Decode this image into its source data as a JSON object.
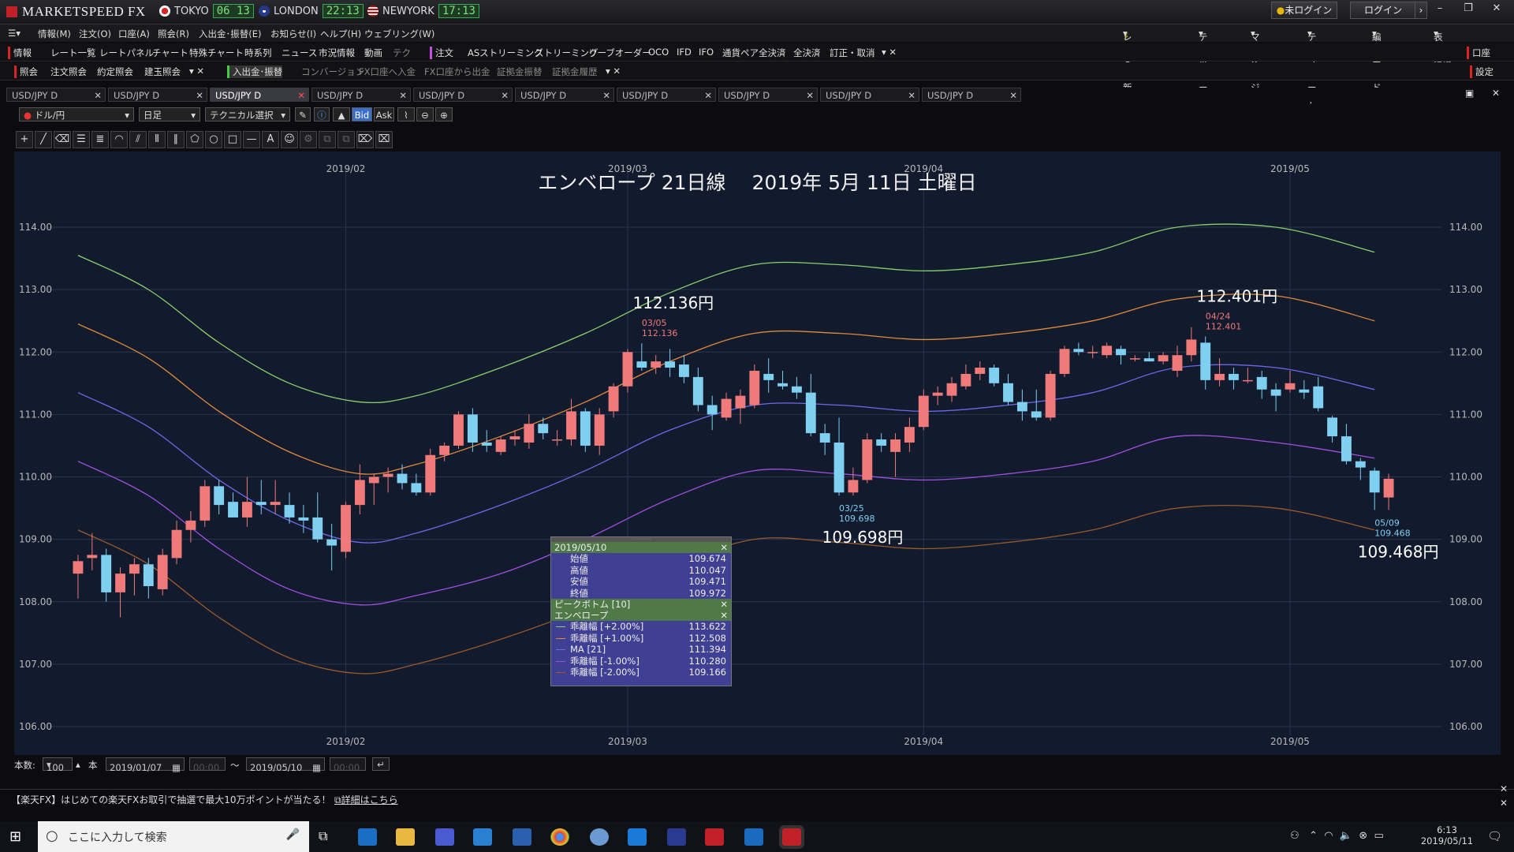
{
  "app": {
    "title": "MARKETSPEED FX"
  },
  "clocks": [
    {
      "city": "TOKYO",
      "time": "06 13"
    },
    {
      "city": "LONDON",
      "time": "22:13"
    },
    {
      "city": "NEWYORK",
      "time": "17:13"
    }
  ],
  "topbar": {
    "login_status": "未ログイン",
    "login_button": "ログイン"
  },
  "menu": [
    "情報(M)",
    "注文(O)",
    "口座(A)",
    "照会(R)",
    "入出金･振替(E)",
    "お知らせ(I)",
    "ヘルプ(H)",
    "ウェブリング(W)"
  ],
  "menu_right": [
    "レート更新",
    "ティッカー",
    "マイページ",
    "テンプレート",
    "編集モード",
    "表示・環境設定"
  ],
  "toolbar1": {
    "group_label": "情報",
    "items": [
      "レート一覧",
      "レートパネル",
      "チャート",
      "特殊チャート",
      "時系列",
      "ニュース",
      "市況情報",
      "動画",
      "テク"
    ],
    "order_label": "注文",
    "order_items": [
      "ASストリーミング",
      "ストリーミング",
      "リーブオーダー",
      "OCO",
      "IFD",
      "IFO",
      "通貨ペア全決済",
      "全決済",
      "訂正・取消"
    ],
    "right_label": "口座"
  },
  "toolbar2": {
    "group_label": "照会",
    "items": [
      "注文照会",
      "約定照会",
      "建玉照会"
    ],
    "transfer_label": "入出金･振替",
    "transfer_items": [
      "コンバージョン",
      "FX口座へ入金",
      "FX口座から出金",
      "証拠金振替",
      "証拠金履歴"
    ],
    "right_label": "設定"
  },
  "tabs": [
    "USD/JPY D",
    "USD/JPY D",
    "USD/JPY D",
    "USD/JPY D",
    "USD/JPY D",
    "USD/JPY D",
    "USD/JPY D",
    "USD/JPY D",
    "USD/JPY D",
    "USD/JPY D"
  ],
  "active_tab": 2,
  "chart_controls": {
    "pair": "ドル/円",
    "period": "日足",
    "technical": "テクニカル選択",
    "bid": "Bid",
    "ask": "Ask"
  },
  "footer": {
    "count_label": "本数:",
    "count_value": "100",
    "unit": "本",
    "from_date": "2019/01/07",
    "from_time": "00:00",
    "tilde": "～",
    "to_date": "2019/05/10",
    "to_time": "00:00"
  },
  "promo": {
    "text": "【楽天FX】はじめての楽天FXお取引で抽選で最大10万ポイントが当たる！",
    "link": "詳細はこちら"
  },
  "taskbar": {
    "search_placeholder": "ここに入力して検索",
    "time": "6:13",
    "date": "2019/05/11"
  },
  "info_panel": {
    "date": "2019/05/10",
    "ohlc": [
      {
        "label": "始値",
        "value": "109.674"
      },
      {
        "label": "高値",
        "value": "110.047"
      },
      {
        "label": "安値",
        "value": "109.471"
      },
      {
        "label": "終値",
        "value": "109.972"
      }
    ],
    "peak_label": "ピークボトム [10]",
    "env_label": "エンベロープ",
    "env_rows": [
      {
        "label": "乖離幅 [+2.00%]",
        "value": "113.622",
        "color": "#8ad06a"
      },
      {
        "label": "乖離幅 [+1.00%]",
        "value": "112.508",
        "color": "#e08a3a"
      },
      {
        "label": "MA [21]",
        "value": "111.394",
        "color": "#6a6ae8"
      },
      {
        "label": "乖離幅 [-1.00%]",
        "value": "110.280",
        "color": "#a050e0"
      },
      {
        "label": "乖離幅 [-2.00%]",
        "value": "109.166",
        "color": "#9a5a2a"
      }
    ]
  },
  "chart_data": {
    "type": "candlestick",
    "title": "エンベロープ 21日線　 2019年 5月 11日 土曜日",
    "ylim": [
      106.0,
      114.5
    ],
    "yticks": [
      "114.00",
      "113.00",
      "112.00",
      "111.00",
      "110.00",
      "109.00",
      "108.00",
      "107.00",
      "106.00"
    ],
    "month_labels": [
      "2019/02",
      "2019/03",
      "2019/04",
      "2019/05"
    ],
    "candles": [
      {
        "o": 108.45,
        "h": 108.75,
        "l": 108.05,
        "c": 108.65
      },
      {
        "o": 108.7,
        "h": 109.1,
        "l": 108.5,
        "c": 108.75
      },
      {
        "o": 108.75,
        "h": 108.85,
        "l": 108.0,
        "c": 108.15
      },
      {
        "o": 108.15,
        "h": 108.55,
        "l": 107.75,
        "c": 108.45
      },
      {
        "o": 108.45,
        "h": 108.7,
        "l": 108.1,
        "c": 108.6
      },
      {
        "o": 108.6,
        "h": 108.7,
        "l": 108.05,
        "c": 108.25
      },
      {
        "o": 108.2,
        "h": 108.85,
        "l": 108.1,
        "c": 108.75
      },
      {
        "o": 108.7,
        "h": 109.3,
        "l": 108.6,
        "c": 109.15
      },
      {
        "o": 109.15,
        "h": 109.45,
        "l": 108.95,
        "c": 109.3
      },
      {
        "o": 109.3,
        "h": 109.95,
        "l": 109.2,
        "c": 109.85
      },
      {
        "o": 109.85,
        "h": 109.95,
        "l": 109.4,
        "c": 109.55
      },
      {
        "o": 109.6,
        "h": 109.75,
        "l": 109.35,
        "c": 109.35
      },
      {
        "o": 109.35,
        "h": 110.0,
        "l": 109.2,
        "c": 109.6
      },
      {
        "o": 109.6,
        "h": 109.95,
        "l": 109.4,
        "c": 109.55
      },
      {
        "o": 109.55,
        "h": 109.95,
        "l": 109.4,
        "c": 109.6
      },
      {
        "o": 109.55,
        "h": 109.75,
        "l": 109.25,
        "c": 109.35
      },
      {
        "o": 109.35,
        "h": 109.55,
        "l": 109.1,
        "c": 109.3
      },
      {
        "o": 109.35,
        "h": 109.75,
        "l": 108.95,
        "c": 109.0
      },
      {
        "o": 109.0,
        "h": 109.25,
        "l": 108.5,
        "c": 108.9
      },
      {
        "o": 108.8,
        "h": 109.6,
        "l": 108.7,
        "c": 109.55
      },
      {
        "o": 109.55,
        "h": 110.2,
        "l": 109.4,
        "c": 109.95
      },
      {
        "o": 109.9,
        "h": 110.05,
        "l": 109.55,
        "c": 110.0
      },
      {
        "o": 110.0,
        "h": 110.15,
        "l": 109.75,
        "c": 110.05
      },
      {
        "o": 110.05,
        "h": 110.2,
        "l": 109.8,
        "c": 109.9
      },
      {
        "o": 109.9,
        "h": 110.05,
        "l": 109.7,
        "c": 109.75
      },
      {
        "o": 109.75,
        "h": 110.45,
        "l": 109.7,
        "c": 110.35
      },
      {
        "o": 110.35,
        "h": 110.55,
        "l": 110.25,
        "c": 110.5
      },
      {
        "o": 110.5,
        "h": 111.05,
        "l": 110.45,
        "c": 111.0
      },
      {
        "o": 111.0,
        "h": 111.1,
        "l": 110.4,
        "c": 110.55
      },
      {
        "o": 110.55,
        "h": 110.75,
        "l": 110.4,
        "c": 110.5
      },
      {
        "o": 110.4,
        "h": 110.65,
        "l": 110.35,
        "c": 110.6
      },
      {
        "o": 110.6,
        "h": 110.75,
        "l": 110.5,
        "c": 110.65
      },
      {
        "o": 110.55,
        "h": 111.0,
        "l": 110.45,
        "c": 110.85
      },
      {
        "o": 110.85,
        "h": 110.95,
        "l": 110.6,
        "c": 110.7
      },
      {
        "o": 110.6,
        "h": 110.75,
        "l": 110.5,
        "c": 110.6
      },
      {
        "o": 110.6,
        "h": 111.25,
        "l": 110.5,
        "c": 111.05
      },
      {
        "o": 111.05,
        "h": 111.1,
        "l": 110.4,
        "c": 110.5
      },
      {
        "o": 110.5,
        "h": 111.1,
        "l": 110.35,
        "c": 111.0
      },
      {
        "o": 111.05,
        "h": 111.5,
        "l": 110.95,
        "c": 111.45
      },
      {
        "o": 111.45,
        "h": 112.05,
        "l": 111.35,
        "c": 112.0
      },
      {
        "o": 111.85,
        "h": 112.14,
        "l": 111.7,
        "c": 111.75
      },
      {
        "o": 111.75,
        "h": 111.95,
        "l": 111.65,
        "c": 111.85
      },
      {
        "o": 111.85,
        "h": 112.05,
        "l": 111.6,
        "c": 111.75
      },
      {
        "o": 111.8,
        "h": 111.95,
        "l": 111.5,
        "c": 111.6
      },
      {
        "o": 111.6,
        "h": 111.75,
        "l": 111.05,
        "c": 111.15
      },
      {
        "o": 111.15,
        "h": 111.3,
        "l": 110.75,
        "c": 111.0
      },
      {
        "o": 110.95,
        "h": 111.35,
        "l": 110.9,
        "c": 111.25
      },
      {
        "o": 111.1,
        "h": 111.4,
        "l": 110.85,
        "c": 111.3
      },
      {
        "o": 111.15,
        "h": 111.8,
        "l": 111.1,
        "c": 111.7
      },
      {
        "o": 111.65,
        "h": 111.9,
        "l": 111.35,
        "c": 111.55
      },
      {
        "o": 111.5,
        "h": 111.7,
        "l": 111.4,
        "c": 111.45
      },
      {
        "o": 111.45,
        "h": 111.6,
        "l": 111.25,
        "c": 111.35
      },
      {
        "o": 111.35,
        "h": 111.65,
        "l": 110.65,
        "c": 110.7
      },
      {
        "o": 110.7,
        "h": 110.85,
        "l": 110.35,
        "c": 110.55
      },
      {
        "o": 110.55,
        "h": 110.95,
        "l": 109.7,
        "c": 109.75
      },
      {
        "o": 109.75,
        "h": 110.15,
        "l": 109.7,
        "c": 109.95
      },
      {
        "o": 109.95,
        "h": 110.7,
        "l": 109.9,
        "c": 110.6
      },
      {
        "o": 110.6,
        "h": 110.7,
        "l": 110.4,
        "c": 110.5
      },
      {
        "o": 110.4,
        "h": 110.7,
        "l": 110.0,
        "c": 110.6
      },
      {
        "o": 110.55,
        "h": 110.95,
        "l": 110.4,
        "c": 110.8
      },
      {
        "o": 110.8,
        "h": 111.4,
        "l": 110.75,
        "c": 111.3
      },
      {
        "o": 111.3,
        "h": 111.45,
        "l": 111.15,
        "c": 111.35
      },
      {
        "o": 111.3,
        "h": 111.6,
        "l": 111.2,
        "c": 111.5
      },
      {
        "o": 111.45,
        "h": 111.8,
        "l": 111.4,
        "c": 111.65
      },
      {
        "o": 111.65,
        "h": 111.85,
        "l": 111.55,
        "c": 111.75
      },
      {
        "o": 111.75,
        "h": 111.8,
        "l": 111.45,
        "c": 111.5
      },
      {
        "o": 111.5,
        "h": 111.65,
        "l": 111.15,
        "c": 111.2
      },
      {
        "o": 111.2,
        "h": 111.4,
        "l": 110.9,
        "c": 111.05
      },
      {
        "o": 111.05,
        "h": 111.4,
        "l": 110.9,
        "c": 110.95
      },
      {
        "o": 110.95,
        "h": 111.7,
        "l": 110.9,
        "c": 111.65
      },
      {
        "o": 111.65,
        "h": 112.1,
        "l": 111.6,
        "c": 112.05
      },
      {
        "o": 112.05,
        "h": 112.15,
        "l": 111.95,
        "c": 112.0
      },
      {
        "o": 112.0,
        "h": 112.1,
        "l": 111.9,
        "c": 112.0
      },
      {
        "o": 111.95,
        "h": 112.15,
        "l": 111.9,
        "c": 112.1
      },
      {
        "o": 112.05,
        "h": 112.1,
        "l": 111.8,
        "c": 111.95
      },
      {
        "o": 111.9,
        "h": 111.95,
        "l": 111.85,
        "c": 111.9
      },
      {
        "o": 111.9,
        "h": 112.0,
        "l": 111.85,
        "c": 111.85
      },
      {
        "o": 111.85,
        "h": 112.0,
        "l": 111.8,
        "c": 111.95
      },
      {
        "o": 111.7,
        "h": 112.1,
        "l": 111.6,
        "c": 111.95
      },
      {
        "o": 111.95,
        "h": 112.4,
        "l": 111.85,
        "c": 112.2
      },
      {
        "o": 112.15,
        "h": 112.25,
        "l": 111.4,
        "c": 111.55
      },
      {
        "o": 111.55,
        "h": 111.9,
        "l": 111.45,
        "c": 111.65
      },
      {
        "o": 111.65,
        "h": 111.75,
        "l": 111.4,
        "c": 111.55
      },
      {
        "o": 111.55,
        "h": 111.75,
        "l": 111.5,
        "c": 111.55
      },
      {
        "o": 111.6,
        "h": 111.7,
        "l": 111.25,
        "c": 111.4
      },
      {
        "o": 111.4,
        "h": 111.5,
        "l": 111.05,
        "c": 111.3
      },
      {
        "o": 111.4,
        "h": 111.7,
        "l": 111.35,
        "c": 111.5
      },
      {
        "o": 111.4,
        "h": 111.55,
        "l": 111.25,
        "c": 111.35
      },
      {
        "o": 111.45,
        "h": 111.6,
        "l": 111.05,
        "c": 111.1
      },
      {
        "o": 110.95,
        "h": 110.98,
        "l": 110.55,
        "c": 110.65
      },
      {
        "o": 110.65,
        "h": 110.85,
        "l": 110.2,
        "c": 110.25
      },
      {
        "o": 110.25,
        "h": 110.3,
        "l": 109.95,
        "c": 110.15
      },
      {
        "o": 110.1,
        "h": 110.15,
        "l": 109.47,
        "c": 109.75
      },
      {
        "o": 109.67,
        "h": 110.05,
        "l": 109.47,
        "c": 109.97
      }
    ],
    "envelopes": [
      {
        "name": "乖離幅 [+2.00%]",
        "color": "#8ad06a",
        "values": [
          [
            0,
            113.55
          ],
          [
            5,
            113.0
          ],
          [
            10,
            112.15
          ],
          [
            15,
            111.5
          ],
          [
            20,
            111.2
          ],
          [
            24,
            111.3
          ],
          [
            30,
            111.75
          ],
          [
            36,
            112.3
          ],
          [
            42,
            112.95
          ],
          [
            48,
            113.4
          ],
          [
            54,
            113.4
          ],
          [
            60,
            113.3
          ],
          [
            66,
            113.4
          ],
          [
            72,
            113.6
          ],
          [
            78,
            114.0
          ],
          [
            85,
            114.0
          ],
          [
            92,
            113.6
          ]
        ]
      },
      {
        "name": "乖離幅 [+1.00%]",
        "color": "#e08a3a",
        "values": [
          [
            0,
            112.45
          ],
          [
            5,
            111.9
          ],
          [
            10,
            111.05
          ],
          [
            15,
            110.4
          ],
          [
            20,
            110.05
          ],
          [
            24,
            110.2
          ],
          [
            30,
            110.65
          ],
          [
            36,
            111.2
          ],
          [
            42,
            111.85
          ],
          [
            48,
            112.3
          ],
          [
            54,
            112.3
          ],
          [
            60,
            112.2
          ],
          [
            66,
            112.3
          ],
          [
            72,
            112.5
          ],
          [
            78,
            112.85
          ],
          [
            85,
            112.9
          ],
          [
            92,
            112.5
          ]
        ]
      },
      {
        "name": "MA [21]",
        "color": "#6a6ae8",
        "values": [
          [
            0,
            111.35
          ],
          [
            5,
            110.8
          ],
          [
            10,
            109.95
          ],
          [
            15,
            109.3
          ],
          [
            20,
            108.95
          ],
          [
            24,
            109.1
          ],
          [
            30,
            109.55
          ],
          [
            36,
            110.1
          ],
          [
            42,
            110.75
          ],
          [
            48,
            111.15
          ],
          [
            54,
            111.15
          ],
          [
            60,
            111.05
          ],
          [
            66,
            111.15
          ],
          [
            72,
            111.35
          ],
          [
            78,
            111.75
          ],
          [
            85,
            111.75
          ],
          [
            92,
            111.4
          ]
        ]
      },
      {
        "name": "乖離幅 [-1.00%]",
        "color": "#a050e0",
        "values": [
          [
            0,
            110.25
          ],
          [
            5,
            109.7
          ],
          [
            10,
            108.85
          ],
          [
            15,
            108.2
          ],
          [
            20,
            107.95
          ],
          [
            24,
            108.1
          ],
          [
            30,
            108.45
          ],
          [
            36,
            109.0
          ],
          [
            42,
            109.65
          ],
          [
            48,
            110.1
          ],
          [
            54,
            110.05
          ],
          [
            60,
            109.95
          ],
          [
            66,
            110.05
          ],
          [
            72,
            110.25
          ],
          [
            78,
            110.65
          ],
          [
            85,
            110.55
          ],
          [
            92,
            110.3
          ]
        ]
      },
      {
        "name": "乖離幅 [-2.00%]",
        "color": "#9a5a2a",
        "values": [
          [
            0,
            109.15
          ],
          [
            5,
            108.6
          ],
          [
            10,
            107.75
          ],
          [
            15,
            107.1
          ],
          [
            20,
            106.85
          ],
          [
            24,
            107.0
          ],
          [
            30,
            107.4
          ],
          [
            36,
            107.9
          ],
          [
            42,
            108.55
          ],
          [
            48,
            109.0
          ],
          [
            54,
            108.95
          ],
          [
            60,
            108.85
          ],
          [
            66,
            108.95
          ],
          [
            72,
            109.15
          ],
          [
            78,
            109.5
          ],
          [
            85,
            109.5
          ],
          [
            92,
            109.15
          ]
        ]
      }
    ],
    "peaks": [
      {
        "index": 40,
        "date": "03/05",
        "value": "112.136",
        "big": "112.136円",
        "kind": "high"
      },
      {
        "index": 54,
        "date": "03/25",
        "value": "109.698",
        "big": "109.698円",
        "kind": "low"
      },
      {
        "index": 80,
        "date": "04/24",
        "value": "112.401",
        "big": "112.401円",
        "kind": "high"
      },
      {
        "index": 92,
        "date": "05/09",
        "value": "109.468",
        "big": "109.468円",
        "kind": "low"
      }
    ]
  }
}
